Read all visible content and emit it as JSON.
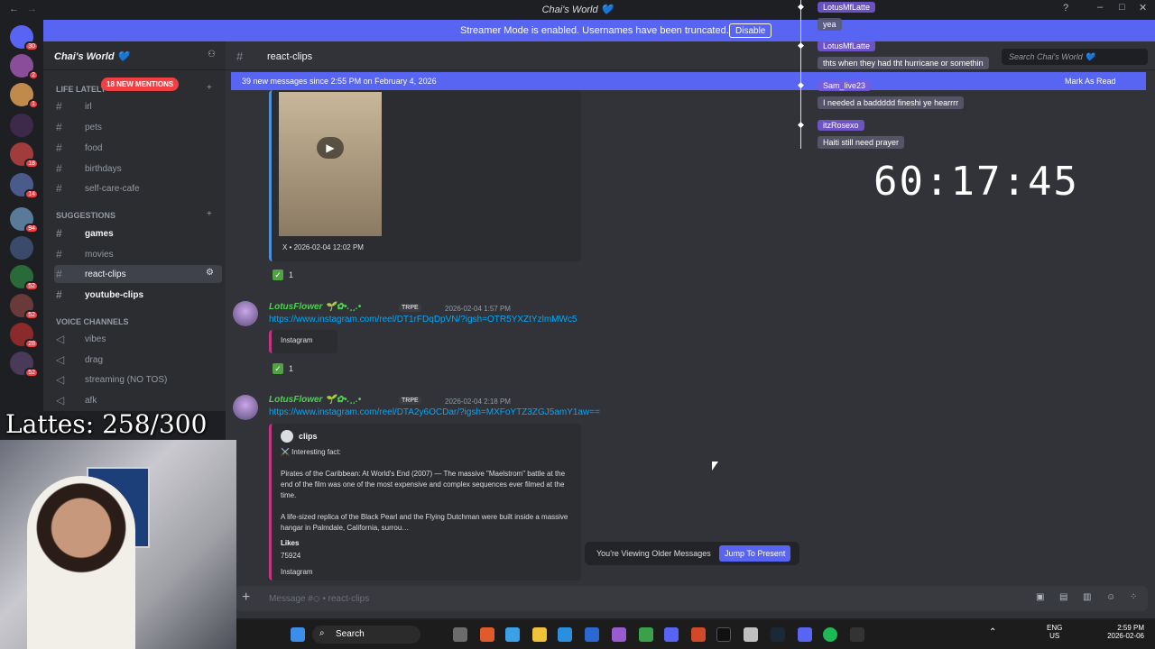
{
  "window": {
    "title": "Chai's World 💙"
  },
  "banner": {
    "text": "Streamer Mode is enabled. Usernames have been truncated.",
    "button": "Disable"
  },
  "server": {
    "name": "Chai's World 💙"
  },
  "mentions": "18 NEW MENTIONS",
  "categories": {
    "life": "LIFE LATELY",
    "suggestions": "SUGGESTIONS",
    "voice": "VOICE CHANNELS"
  },
  "channels": {
    "irl": "irl",
    "pets": "pets",
    "food": "food",
    "birthdays": "birthdays",
    "selfcare": "self-care-cafe",
    "games": "games",
    "movies": "movies",
    "reactclips": "react-clips",
    "youtube": "youtube-clips",
    "vibes": "vibes",
    "drag": "drag",
    "streaming": "streaming (NO TOS)",
    "afk": "afk"
  },
  "server_badges": [
    "30",
    "2",
    "1",
    "18",
    "14",
    "94",
    "52",
    "52",
    "28",
    "52"
  ],
  "lattes": "Lattes: 258/300",
  "channel_header": {
    "name": "react-clips",
    "search_placeholder": "Search Chai's World 💙"
  },
  "newbar": {
    "left": "39 new messages since 2:55 PM on February 4, 2026",
    "right": "Mark As Read"
  },
  "messages": [
    {
      "embed_footer": "X • 2026-02-04 12:02 PM",
      "reaction_count": "1"
    },
    {
      "author": "LotusFlower 🌱✿•.¸¸.•",
      "tag": "TRPE",
      "time": "2026-02-04 1:57 PM",
      "link": "https://www.instagram.com/reel/DT1rFDqDpVN/?igsh=OTR5YXZtYzlmMWc5",
      "embed_title": "Instagram",
      "reaction_count": "1"
    },
    {
      "author": "LotusFlower 🌱✿•.¸¸.•",
      "tag": "TRPE",
      "time": "2026-02-04 2:18 PM",
      "link": "https://www.instagram.com/reel/DTA2y6OCDar/?igsh=MXFoYTZ3ZGJ5amY1aw==",
      "embed_author": "clips",
      "embed_heading": "⚔️ Interesting fact:",
      "embed_p1": "Pirates of the Caribbean: At World's End (2007) — The massive \"Maelstrom\" battle at the end of the film was one of the most expensive and complex sequences ever filmed at the time.",
      "embed_p2": "A life-sized replica of the Black Pearl and the Flying Dutchman were built inside a massive hangar in Palmdale, California, surrou…",
      "likes_label": "Likes",
      "likes_value": "75924",
      "embed_footer": "Instagram"
    }
  ],
  "older": {
    "text": "You're Viewing Older Messages",
    "button": "Jump To Present"
  },
  "composer": {
    "placeholder": "Message #◇ • react-clips"
  },
  "taskbar": {
    "search": "Search",
    "lang1": "ENG",
    "lang2": "US",
    "time": "2:59 PM",
    "date": "2026-02-06"
  },
  "chat": [
    {
      "name": "LotusMfLatte",
      "msg": "yea"
    },
    {
      "name": "LotusMfLatte",
      "msg": "thts when they had tht hurricane or somethin"
    },
    {
      "name": "Sam_live23",
      "msg": "I needed a baddddd fineshi ye hearrrr"
    },
    {
      "name": "itzRosexo",
      "msg": "Haiti still need prayer"
    }
  ],
  "timer": "60:17:45",
  "colors": {
    "accent": "#5865f2",
    "link": "#00a8fc",
    "username": "#4bd34b",
    "mention": "#f23f43"
  }
}
